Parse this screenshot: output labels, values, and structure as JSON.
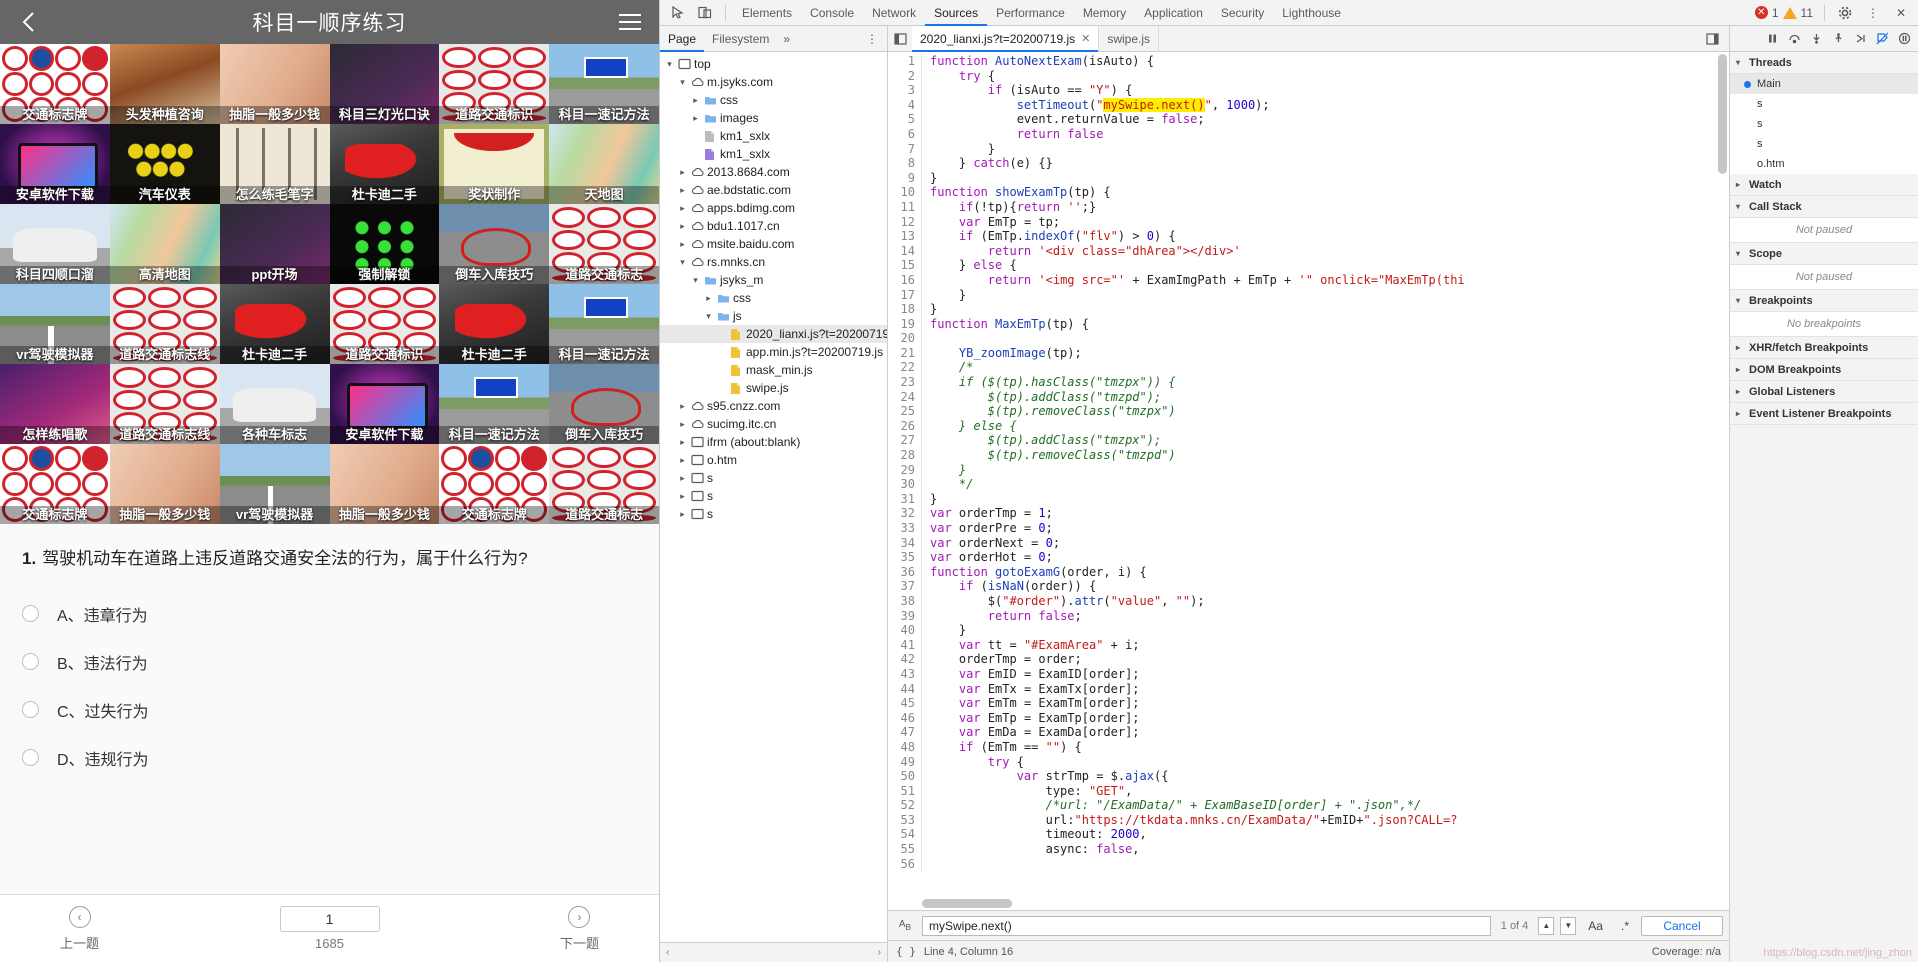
{
  "phone": {
    "title": "科目一顺序练习",
    "back_icon": "chevron-left-icon",
    "menu_icon": "hamburger-menu-icon",
    "ads": [
      {
        "caption": "交通标志牌",
        "art": "art-signs"
      },
      {
        "caption": "头发种植咨询",
        "art": "art-hair"
      },
      {
        "caption": "抽脂一般多少钱",
        "art": "art-skin"
      },
      {
        "caption": "科目三灯光口诀",
        "art": "art-dark"
      },
      {
        "caption": "道路交通标识",
        "art": "art-wheel"
      },
      {
        "caption": "科目一速记方法",
        "art": "art-road"
      },
      {
        "caption": "安卓软件下载",
        "art": "art-tablet"
      },
      {
        "caption": "汽车仪表",
        "art": "art-dash"
      },
      {
        "caption": "怎么练毛笔字",
        "art": "art-calli"
      },
      {
        "caption": "杜卡迪二手",
        "art": "art-moto"
      },
      {
        "caption": "奖状制作",
        "art": "art-cert"
      },
      {
        "caption": "天地图",
        "art": "art-map"
      },
      {
        "caption": "科目四顺口溜",
        "art": "art-car"
      },
      {
        "caption": "高清地图",
        "art": "art-map"
      },
      {
        "caption": "ppt开场",
        "art": "art-dark"
      },
      {
        "caption": "强制解锁",
        "art": "art-lock"
      },
      {
        "caption": "倒车入库技巧",
        "art": "art-mirror"
      },
      {
        "caption": "道路交通标志",
        "art": "art-wheel"
      },
      {
        "caption": "vr驾驶模拟器",
        "art": "art-vr"
      },
      {
        "caption": "道路交通标志线",
        "art": "art-wheel"
      },
      {
        "caption": "杜卡迪二手",
        "art": "art-moto"
      },
      {
        "caption": "道路交通标识",
        "art": "art-wheel"
      },
      {
        "caption": "杜卡迪二手",
        "art": "art-moto"
      },
      {
        "caption": "科目一速记方法",
        "art": "art-road"
      },
      {
        "caption": "怎样练唱歌",
        "art": "art-sing"
      },
      {
        "caption": "道路交通标志线",
        "art": "art-wheel"
      },
      {
        "caption": "各种车标志",
        "art": "art-car"
      },
      {
        "caption": "安卓软件下载",
        "art": "art-tablet"
      },
      {
        "caption": "科目一速记方法",
        "art": "art-road"
      },
      {
        "caption": "倒车入库技巧",
        "art": "art-mirror"
      },
      {
        "caption": "交通标志牌",
        "art": "art-signs"
      },
      {
        "caption": "抽脂一般多少钱",
        "art": "art-skin"
      },
      {
        "caption": "vr驾驶模拟器",
        "art": "art-vr"
      },
      {
        "caption": "抽脂一般多少钱",
        "art": "art-skin"
      },
      {
        "caption": "交通标志牌",
        "art": "art-signs"
      },
      {
        "caption": "道路交通标志",
        "art": "art-wheel"
      }
    ],
    "question": {
      "number": "1.",
      "text": "驾驶机动车在道路上违反道路交通安全法的行为，属于什么行为?",
      "options": [
        {
          "label": "A、违章行为"
        },
        {
          "label": "B、违法行为"
        },
        {
          "label": "C、过失行为"
        },
        {
          "label": "D、违规行为"
        }
      ]
    },
    "footer": {
      "prev_label": "上一题",
      "prev_icon": "chevron-left-circle-icon",
      "next_label": "下一题",
      "next_icon": "chevron-right-circle-icon",
      "current": "1",
      "total": "1685"
    }
  },
  "devtools": {
    "toolbar": {
      "inspect_icon": "inspect-cursor-icon",
      "device_icon": "device-toggle-icon",
      "tabs": [
        {
          "label": "Elements",
          "active": false
        },
        {
          "label": "Console",
          "active": false
        },
        {
          "label": "Network",
          "active": false
        },
        {
          "label": "Sources",
          "active": true
        },
        {
          "label": "Performance",
          "active": false
        },
        {
          "label": "Memory",
          "active": false
        },
        {
          "label": "Application",
          "active": false
        },
        {
          "label": "Security",
          "active": false
        },
        {
          "label": "Lighthouse",
          "active": false
        }
      ],
      "error_count": "1",
      "warning_count": "11",
      "settings_icon": "gear-icon",
      "more_icon": "kebab-menu-icon",
      "close_icon": "close-icon"
    },
    "navigator": {
      "tabs": [
        {
          "label": "Page",
          "active": true
        },
        {
          "label": "Filesystem",
          "active": false
        }
      ],
      "more_label": "»",
      "menu_icon": "kebab-menu-icon",
      "tree": [
        {
          "label": "top",
          "indent": 0,
          "twisty": "▾",
          "icon": "frame-icon",
          "selected": false
        },
        {
          "label": "m.jsyks.com",
          "indent": 1,
          "twisty": "▾",
          "icon": "cloud-icon",
          "selected": false
        },
        {
          "label": "css",
          "indent": 2,
          "twisty": "▸",
          "icon": "folder-icon",
          "selected": false
        },
        {
          "label": "images",
          "indent": 2,
          "twisty": "▸",
          "icon": "folder-icon",
          "selected": false
        },
        {
          "label": "km1_sxlx",
          "indent": 2,
          "twisty": "",
          "icon": "file-icon",
          "selected": false
        },
        {
          "label": "km1_sxlx",
          "indent": 2,
          "twisty": "",
          "icon": "file-purple-icon",
          "selected": false
        },
        {
          "label": "2013.8684.com",
          "indent": 1,
          "twisty": "▸",
          "icon": "cloud-icon",
          "selected": false
        },
        {
          "label": "ae.bdstatic.com",
          "indent": 1,
          "twisty": "▸",
          "icon": "cloud-icon",
          "selected": false
        },
        {
          "label": "apps.bdimg.com",
          "indent": 1,
          "twisty": "▸",
          "icon": "cloud-icon",
          "selected": false
        },
        {
          "label": "bdu1.1017.cn",
          "indent": 1,
          "twisty": "▸",
          "icon": "cloud-icon",
          "selected": false
        },
        {
          "label": "msite.baidu.com",
          "indent": 1,
          "twisty": "▸",
          "icon": "cloud-icon",
          "selected": false
        },
        {
          "label": "rs.mnks.cn",
          "indent": 1,
          "twisty": "▾",
          "icon": "cloud-icon",
          "selected": false
        },
        {
          "label": "jsyks_m",
          "indent": 2,
          "twisty": "▾",
          "icon": "folder-icon",
          "selected": false
        },
        {
          "label": "css",
          "indent": 3,
          "twisty": "▸",
          "icon": "folder-icon",
          "selected": false
        },
        {
          "label": "js",
          "indent": 3,
          "twisty": "▾",
          "icon": "folder-icon",
          "selected": false
        },
        {
          "label": "2020_lianxi.js?t=20200719.js",
          "indent": 4,
          "twisty": "",
          "icon": "file-js-icon",
          "selected": true
        },
        {
          "label": "app.min.js?t=20200719.js",
          "indent": 4,
          "twisty": "",
          "icon": "file-js-icon",
          "selected": false
        },
        {
          "label": "mask_min.js",
          "indent": 4,
          "twisty": "",
          "icon": "file-js-icon",
          "selected": false
        },
        {
          "label": "swipe.js",
          "indent": 4,
          "twisty": "",
          "icon": "file-js-icon",
          "selected": false
        },
        {
          "label": "s95.cnzz.com",
          "indent": 1,
          "twisty": "▸",
          "icon": "cloud-icon",
          "selected": false
        },
        {
          "label": "sucimg.itc.cn",
          "indent": 1,
          "twisty": "▸",
          "icon": "cloud-icon",
          "selected": false
        },
        {
          "label": "ifrm (about:blank)",
          "indent": 1,
          "twisty": "▸",
          "icon": "frame-icon",
          "selected": false
        },
        {
          "label": "o.htm",
          "indent": 1,
          "twisty": "▸",
          "icon": "frame-icon",
          "selected": false
        },
        {
          "label": "s",
          "indent": 1,
          "twisty": "▸",
          "icon": "frame-icon",
          "selected": false
        },
        {
          "label": "s",
          "indent": 1,
          "twisty": "▸",
          "icon": "frame-icon",
          "selected": false
        },
        {
          "label": "s",
          "indent": 1,
          "twisty": "▸",
          "icon": "frame-icon",
          "selected": false
        }
      ]
    },
    "source": {
      "tabs": [
        {
          "label": "2020_lianxi.js?t=20200719.js",
          "active": true,
          "closable": true
        },
        {
          "label": "swipe.js",
          "active": false,
          "closable": false
        }
      ],
      "panel_toggle_icon": "show-navigator-icon",
      "expand_icon": "show-debugger-icon",
      "code": [
        {
          "n": 1,
          "html": "<span class=\"kw\">function</span> <span class=\"fn\">AutoNextExam</span>(isAuto) {"
        },
        {
          "n": 2,
          "html": "    <span class=\"kw\">try</span> {"
        },
        {
          "n": 3,
          "html": "        <span class=\"kw\">if</span> (isAuto == <span class=\"str\">\"Y\"</span>) {"
        },
        {
          "n": 4,
          "html": "            <span class=\"fn\">setTimeout</span>(<span class=\"str\">\"</span><span class=\"hl str\">mySwipe.next()</span><span class=\"str\">\"</span>, <span class=\"num\">1000</span>);"
        },
        {
          "n": 5,
          "html": "            event.returnValue = <span class=\"kw\">false</span>;"
        },
        {
          "n": 6,
          "html": "            <span class=\"kw\">return</span> <span class=\"kw\">false</span>"
        },
        {
          "n": 7,
          "html": "        }"
        },
        {
          "n": 8,
          "html": "    } <span class=\"kw\">catch</span>(e) {}"
        },
        {
          "n": 9,
          "html": "}"
        },
        {
          "n": 10,
          "html": "<span class=\"kw\">function</span> <span class=\"fn\">showExamTp</span>(tp) {"
        },
        {
          "n": 11,
          "html": "    <span class=\"kw\">if</span>(!tp){<span class=\"kw\">return</span> <span class=\"str\">''</span>;}"
        },
        {
          "n": 12,
          "html": "    <span class=\"kw\">var</span> EmTp = tp;"
        },
        {
          "n": 13,
          "html": "    <span class=\"kw\">if</span> (EmTp.<span class=\"fn\">indexOf</span>(<span class=\"str\">\"flv\"</span>) &gt; <span class=\"num\">0</span>) {"
        },
        {
          "n": 14,
          "html": "        <span class=\"kw\">return</span> <span class=\"str\">'&lt;div class=\"dhArea\"&gt;&lt;/div&gt;'</span>"
        },
        {
          "n": 15,
          "html": "    } <span class=\"kw\">else</span> {"
        },
        {
          "n": 16,
          "html": "        <span class=\"kw\">return</span> <span class=\"str\">'&lt;img src=\"'</span> + ExamImgPath + EmTp + <span class=\"str\">'\" onclick=\"MaxEmTp(thi</span>"
        },
        {
          "n": 17,
          "html": "    }"
        },
        {
          "n": 18,
          "html": "}"
        },
        {
          "n": 19,
          "html": "<span class=\"kw\">function</span> <span class=\"fn\">MaxEmTp</span>(tp) {"
        },
        {
          "n": 20,
          "html": ""
        },
        {
          "n": 21,
          "html": "    <span class=\"fn\">YB_zoomImage</span>(tp);"
        },
        {
          "n": 22,
          "html": "    <span class=\"com\">/*</span>"
        },
        {
          "n": 23,
          "html": "    <span class=\"com\">if ($(tp).hasClass(\"tmzpx\")) {</span>"
        },
        {
          "n": 24,
          "html": "        <span class=\"com\">$(tp).addClass(\"tmzpd\");</span>"
        },
        {
          "n": 25,
          "html": "        <span class=\"com\">$(tp).removeClass(\"tmzpx\")</span>"
        },
        {
          "n": 26,
          "html": "    <span class=\"com\">} else {</span>"
        },
        {
          "n": 27,
          "html": "        <span class=\"com\">$(tp).addClass(\"tmzpx\");</span>"
        },
        {
          "n": 28,
          "html": "        <span class=\"com\">$(tp).removeClass(\"tmzpd\")</span>"
        },
        {
          "n": 29,
          "html": "    <span class=\"com\">}</span>"
        },
        {
          "n": 30,
          "html": "    <span class=\"com\">*/</span>"
        },
        {
          "n": 31,
          "html": "}"
        },
        {
          "n": 32,
          "html": "<span class=\"kw\">var</span> orderTmp = <span class=\"num\">1</span>;"
        },
        {
          "n": 33,
          "html": "<span class=\"kw\">var</span> orderPre = <span class=\"num\">0</span>;"
        },
        {
          "n": 34,
          "html": "<span class=\"kw\">var</span> orderNext = <span class=\"num\">0</span>;"
        },
        {
          "n": 35,
          "html": "<span class=\"kw\">var</span> orderHot = <span class=\"num\">0</span>;"
        },
        {
          "n": 36,
          "html": "<span class=\"kw\">function</span> <span class=\"fn\">gotoExamG</span>(order, i) {"
        },
        {
          "n": 37,
          "html": "    <span class=\"kw\">if</span> (<span class=\"fn\">isNaN</span>(order)) {"
        },
        {
          "n": 38,
          "html": "        $(<span class=\"str\">\"#order\"</span>).<span class=\"fn\">attr</span>(<span class=\"str\">\"value\"</span>, <span class=\"str\">\"\"</span>);"
        },
        {
          "n": 39,
          "html": "        <span class=\"kw\">return</span> <span class=\"kw\">false</span>;"
        },
        {
          "n": 40,
          "html": "    }"
        },
        {
          "n": 41,
          "html": "    <span class=\"kw\">var</span> tt = <span class=\"str\">\"#ExamArea\"</span> + i;"
        },
        {
          "n": 42,
          "html": "    orderTmp = order;"
        },
        {
          "n": 43,
          "html": "    <span class=\"kw\">var</span> EmID = ExamID[order];"
        },
        {
          "n": 44,
          "html": "    <span class=\"kw\">var</span> EmTx = ExamTx[order];"
        },
        {
          "n": 45,
          "html": "    <span class=\"kw\">var</span> EmTm = ExamTm[order];"
        },
        {
          "n": 46,
          "html": "    <span class=\"kw\">var</span> EmTp = ExamTp[order];"
        },
        {
          "n": 47,
          "html": "    <span class=\"kw\">var</span> EmDa = ExamDa[order];"
        },
        {
          "n": 48,
          "html": "    <span class=\"kw\">if</span> (EmTm == <span class=\"str\">\"\"</span>) {"
        },
        {
          "n": 49,
          "html": "        <span class=\"kw\">try</span> {"
        },
        {
          "n": 50,
          "html": "            <span class=\"kw\">var</span> strTmp = $.<span class=\"fn\">ajax</span>({"
        },
        {
          "n": 51,
          "html": "                type: <span class=\"str\">\"GET\"</span>,"
        },
        {
          "n": 52,
          "html": "                <span class=\"com\">/*url: \"/ExamData/\" + ExamBaseID[order] + \".json\",*/</span>"
        },
        {
          "n": 53,
          "html": "                url:<span class=\"str\">\"https://tkdata.mnks.cn/ExamData/\"</span>+EmID+<span class=\"str\">\".json?CALL=?</span>"
        },
        {
          "n": 54,
          "html": "                timeout: <span class=\"num\">2000</span>,"
        },
        {
          "n": 55,
          "html": "                async: <span class=\"kw\">false</span>,"
        },
        {
          "n": 56,
          "html": ""
        }
      ],
      "search": {
        "icon": "ab-search-icon",
        "value": "mySwipe.next()",
        "matches": "1 of 4",
        "prev_icon": "caret-up-icon",
        "next_icon": "caret-down-icon",
        "match_case_label": "Aa",
        "regex_label": ".*",
        "cancel_label": "Cancel"
      },
      "status": {
        "format_icon": "pretty-print-icon",
        "position": "Line 4, Column 16",
        "coverage": "Coverage: n/a"
      }
    },
    "debugger": {
      "toolbar_icons": [
        "pause-icon",
        "step-over-icon",
        "step-into-icon",
        "step-out-icon",
        "step-icon",
        "deactivate-breakpoints-icon",
        "pause-exceptions-icon"
      ],
      "sections": [
        {
          "title": "Threads",
          "arrow": "▾",
          "type": "threads",
          "threads": [
            {
              "label": "Main",
              "active": true
            },
            {
              "label": "s",
              "active": false
            },
            {
              "label": "s",
              "active": false
            },
            {
              "label": "s",
              "active": false
            },
            {
              "label": "o.htm",
              "active": false
            }
          ]
        },
        {
          "title": "Watch",
          "arrow": "▸",
          "type": "plain"
        },
        {
          "title": "Call Stack",
          "arrow": "▾",
          "type": "empty",
          "empty_text": "Not paused"
        },
        {
          "title": "Scope",
          "arrow": "▾",
          "type": "empty",
          "empty_text": "Not paused"
        },
        {
          "title": "Breakpoints",
          "arrow": "▾",
          "type": "empty",
          "empty_text": "No breakpoints"
        },
        {
          "title": "XHR/fetch Breakpoints",
          "arrow": "▸",
          "type": "plain"
        },
        {
          "title": "DOM Breakpoints",
          "arrow": "▸",
          "type": "plain"
        },
        {
          "title": "Global Listeners",
          "arrow": "▸",
          "type": "plain"
        },
        {
          "title": "Event Listener Breakpoints",
          "arrow": "▸",
          "type": "plain"
        }
      ]
    },
    "watermark": "https://blog.csdn.net/jing_zhon"
  }
}
